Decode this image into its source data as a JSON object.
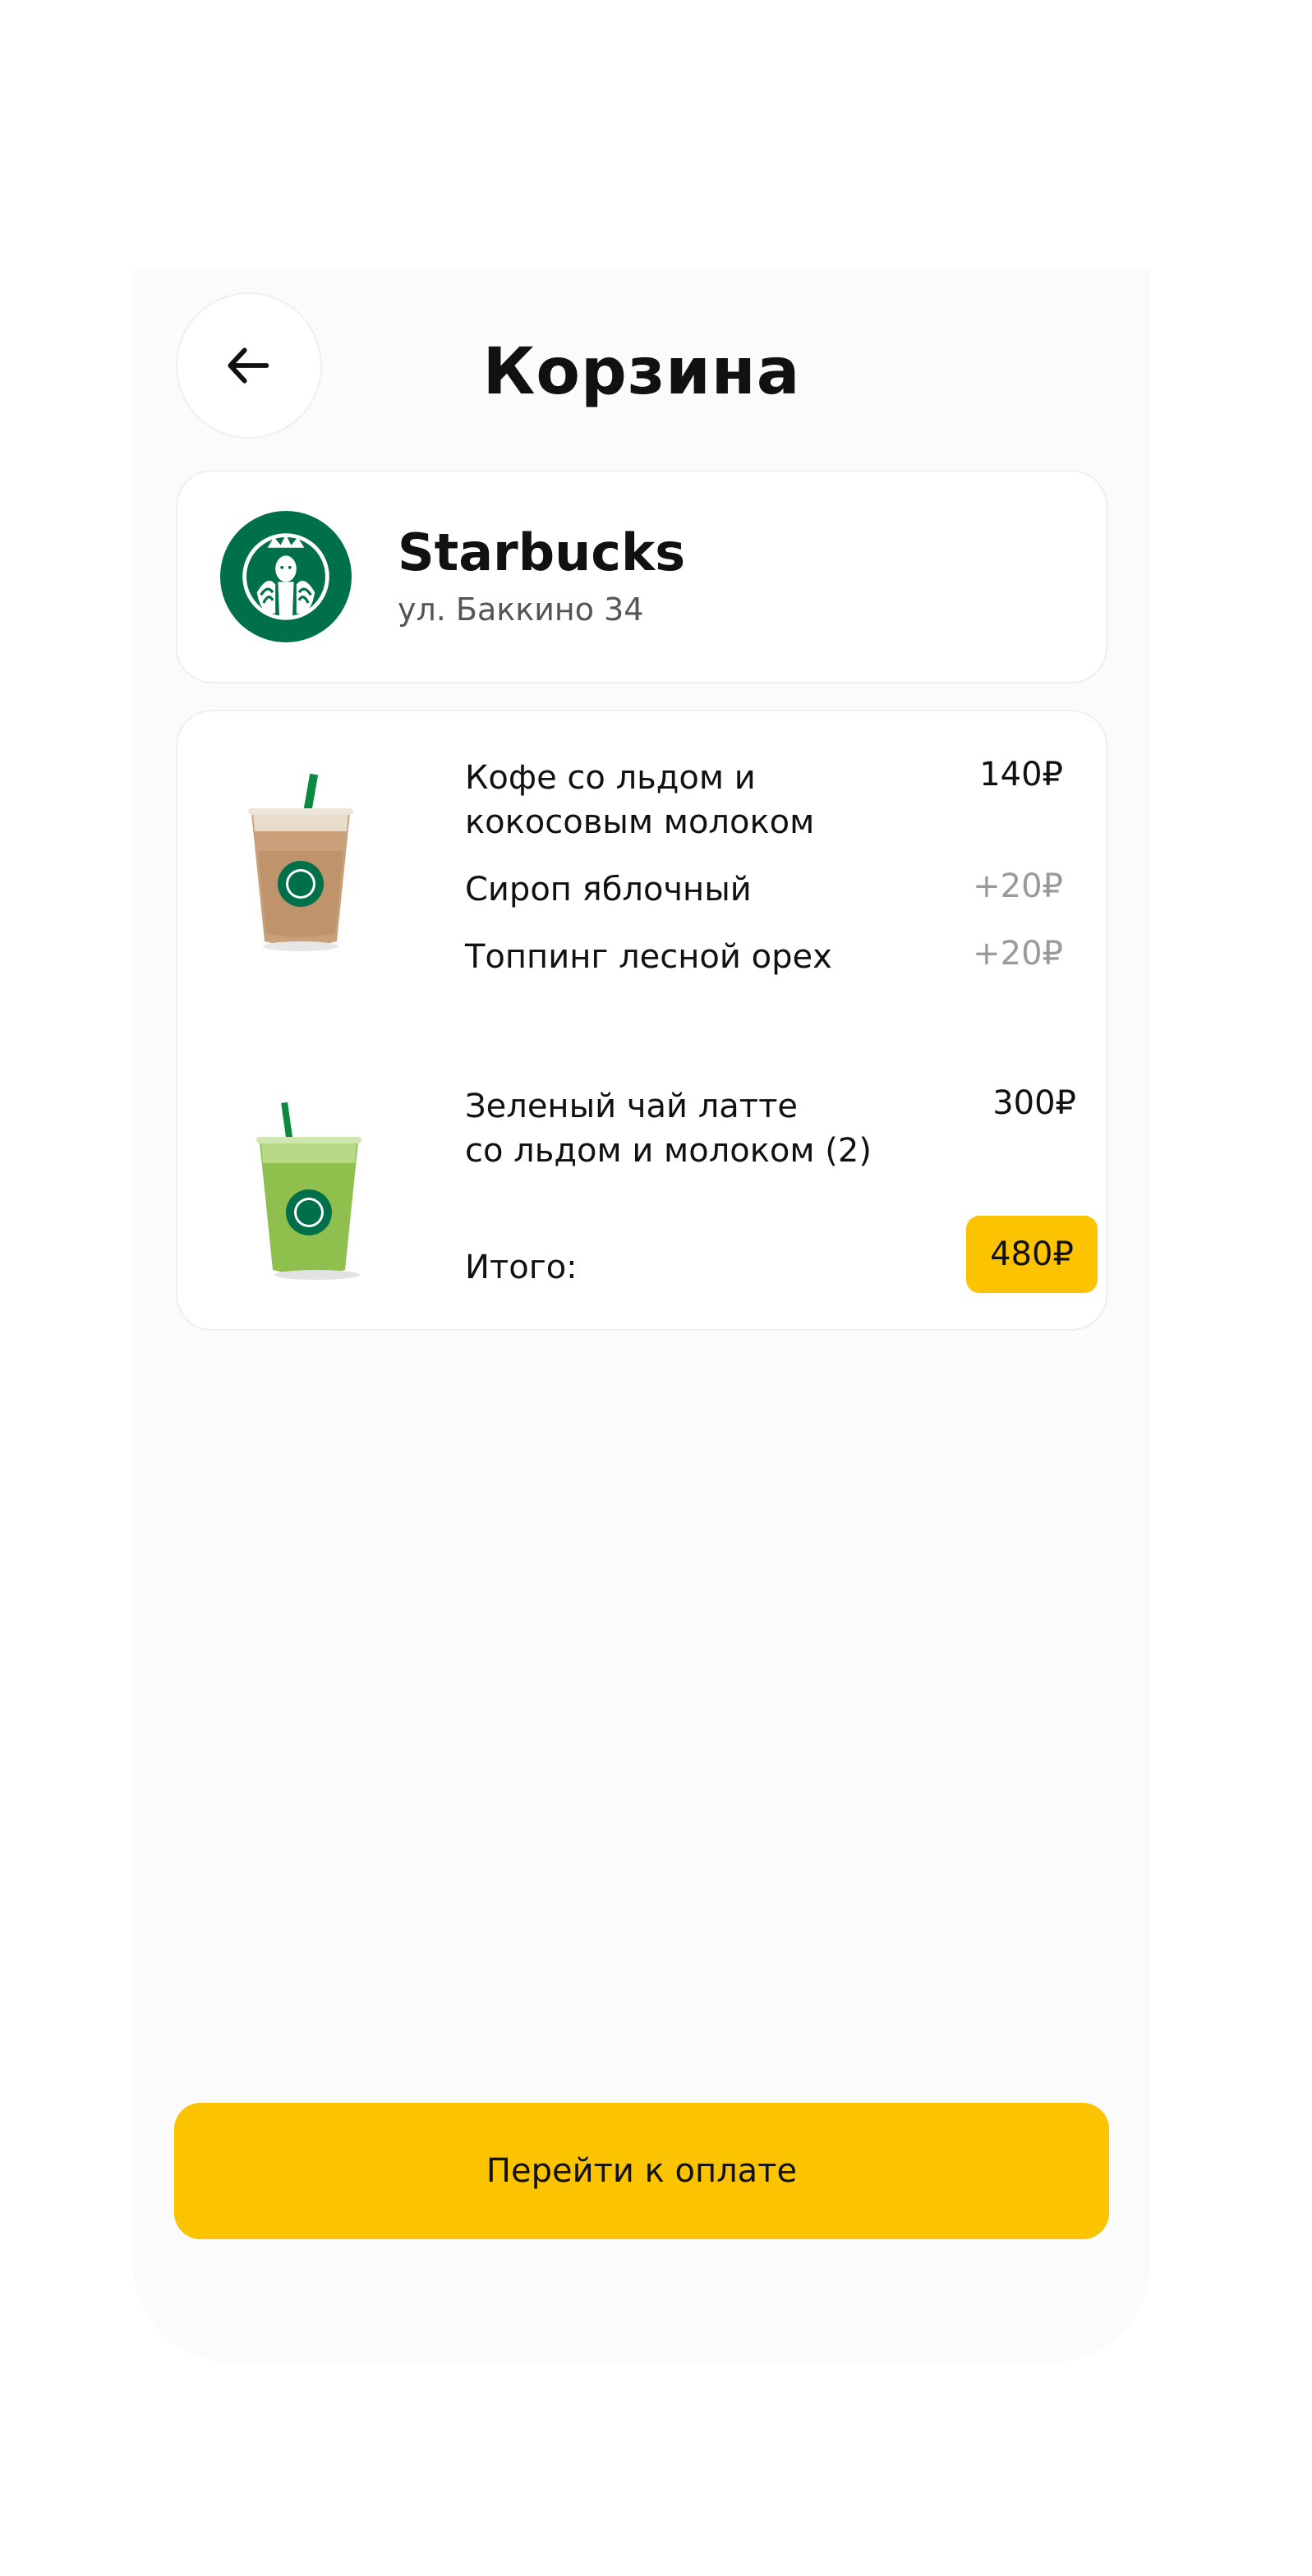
{
  "header": {
    "title": "Корзина",
    "back_icon": "arrow-left-icon"
  },
  "store": {
    "name": "Starbucks",
    "address": "ул. Баккино 34",
    "logo_icon": "starbucks-logo",
    "logo_color": "#00704A"
  },
  "cart": {
    "items": [
      {
        "name": "Кофе со льдом и\nкокосовым молоком",
        "price": "140₽",
        "image": "iced-coffee-cup",
        "addons": [
          {
            "name": "Сироп яблочный",
            "price": "+20₽"
          },
          {
            "name": "Топпинг лесной орех",
            "price": "+20₽"
          }
        ]
      },
      {
        "name": "Зеленый чай латте\nсо льдом и молоком (2)",
        "price": "300₽",
        "image": "iced-matcha-cup"
      }
    ],
    "total_label": "Итого:",
    "total_value": "480₽"
  },
  "checkout": {
    "button_label": "Перейти к оплате"
  },
  "colors": {
    "accent": "#FCC300",
    "background": "#FBFBFB",
    "card": "#FFFFFF",
    "muted_text": "#9A9A9A"
  }
}
